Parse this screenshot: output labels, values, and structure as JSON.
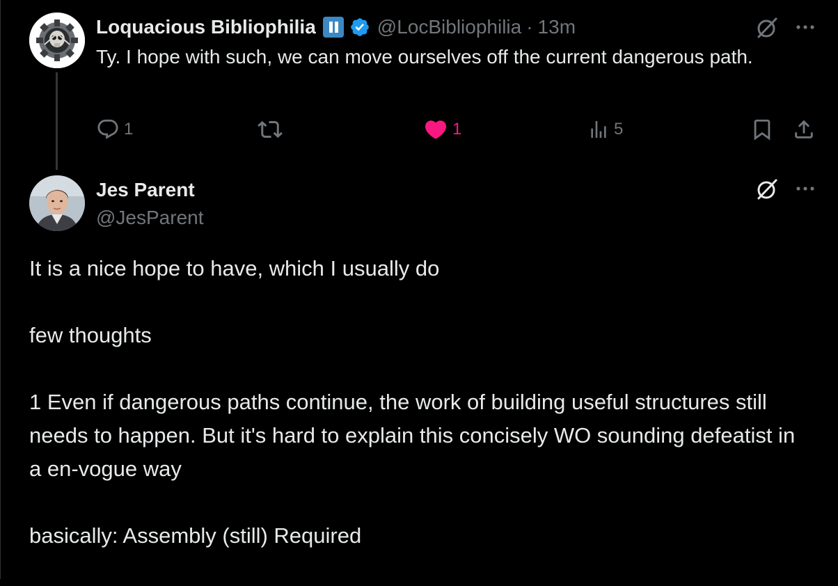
{
  "reply_tweet": {
    "display_name": "Loquacious Bibliophilia",
    "handle": "@LocBibliophilia",
    "separator": "·",
    "time": "13m",
    "text": "Ty. I hope with such, we can move ourselves off the current dangerous path.",
    "stats": {
      "replies": "1",
      "reposts": "",
      "likes": "1",
      "views": "5"
    },
    "liked": true,
    "colors": {
      "like_active": "#f91880",
      "verified": "#1d9bf0",
      "pause_badge": "#3b88c3"
    },
    "icons": [
      "pause-button-icon",
      "verified-badge-icon",
      "grok-icon",
      "more-icon",
      "reply-icon",
      "repost-icon",
      "heart-icon",
      "views-icon",
      "bookmark-icon",
      "share-icon"
    ]
  },
  "main_tweet": {
    "display_name": "Jes Parent",
    "handle": "@JesParent",
    "paragraphs": [
      "It is a nice hope to have, which I usually do",
      "few thoughts",
      "1 Even if dangerous paths continue, the work of building useful structures still needs to happen. But it's hard to explain this concisely WO sounding defeatist in a en-vogue way",
      "basically: Assembly (still) Required"
    ]
  },
  "theme": {
    "background": "#000000",
    "primary_text": "#e7e9ea",
    "secondary_text": "#71767b"
  }
}
